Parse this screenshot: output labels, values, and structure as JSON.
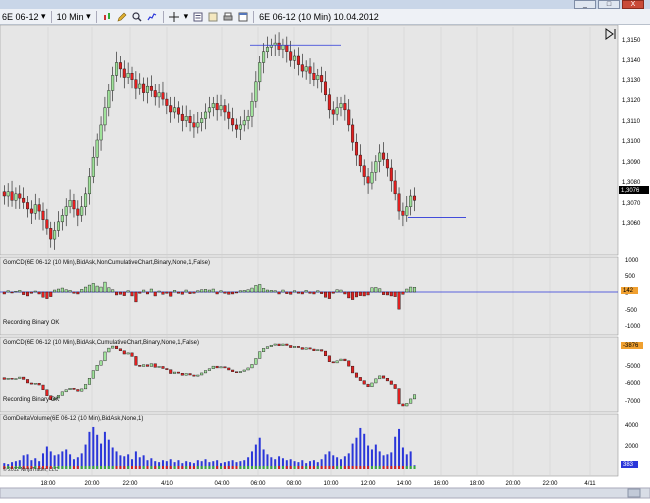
{
  "window": {
    "buttons": [
      "_",
      "□",
      "X"
    ]
  },
  "toolbar": {
    "instrument": "6E 06-12",
    "interval": "10 Min",
    "date_label": "6E 06-12 (10 Min)  10.04.2012",
    "icons": [
      "chart-style-icon",
      "pencil-icon",
      "zoom-icon",
      "indicators-icon",
      "crosshair-icon",
      "properties-icon",
      "data-box-icon",
      "print-icon",
      "window-icon"
    ]
  },
  "price_axis": {
    "ticks": [
      "1,3150",
      "1,3140",
      "1,3130",
      "1,3120",
      "1,3110",
      "1,3100",
      "1,3090",
      "1,3080",
      "1,3070",
      "1,3060"
    ],
    "current": "1,3076"
  },
  "panels": {
    "p1": {
      "title": "GomCD(6E 06-12 (10 Min),BidAsk,NonCumulativeChart,Binary,None,1,False)",
      "ticks": [
        "1000",
        "500",
        "0",
        "-500",
        "-1000"
      ],
      "status": "Recording Binary OK",
      "value": "142"
    },
    "p2": {
      "title": "GomCD(6E 06-12 (10 Min),BidAsk,CumulativeChart,Binary,None,1,False)",
      "ticks": [
        "-5000",
        "-6000",
        "-7000"
      ],
      "status": "Recording Binary OK",
      "value": "-3876"
    },
    "p3": {
      "title": "GomDeltaVolume(6E 06-12 (10 Min),BidAsk,None,1)",
      "ticks": [
        "4000",
        "2000"
      ],
      "value": "383",
      "copyright": "© 2012 NinjaTrader, LLC"
    }
  },
  "time_axis": [
    "18:00",
    "20:00",
    "22:00",
    "4/10",
    "04:00",
    "06:00",
    "08:00",
    "10:00",
    "12:00",
    "14:00",
    "16:00",
    "18:00",
    "20:00",
    "22:00",
    "4/11"
  ],
  "colors": {
    "up": "#9fe29a",
    "down": "#e12020",
    "line": "#2a36d9",
    "background": "#e6e6e6"
  },
  "chart_data": {
    "type": "candlestick",
    "start_time": "17:00",
    "bar_interval_minutes": 10,
    "price_ylim": [
      1.3053,
      1.3157
    ],
    "horizontal_lines": [
      1.3149,
      1.3069
    ],
    "arrow_down_at": "14:20",
    "price_close": [
      1.3079,
      1.3081,
      1.3077,
      1.308,
      1.3078,
      1.3076,
      1.3073,
      1.3071,
      1.3075,
      1.3072,
      1.3068,
      1.3064,
      1.3059,
      1.3063,
      1.3067,
      1.307,
      1.3074,
      1.3077,
      1.3073,
      1.307,
      1.3074,
      1.308,
      1.3088,
      1.3097,
      1.3105,
      1.3112,
      1.312,
      1.3128,
      1.3135,
      1.3141,
      1.3138,
      1.3134,
      1.3136,
      1.3133,
      1.3129,
      1.3131,
      1.3127,
      1.313,
      1.3128,
      1.3125,
      1.3127,
      1.3124,
      1.3121,
      1.3118,
      1.312,
      1.3117,
      1.3114,
      1.3116,
      1.3113,
      1.3111,
      1.3113,
      1.3115,
      1.3118,
      1.312,
      1.3122,
      1.3119,
      1.3121,
      1.3118,
      1.3115,
      1.3112,
      1.311,
      1.3112,
      1.3114,
      1.3116,
      1.3123,
      1.3132,
      1.3141,
      1.3146,
      1.3148,
      1.3149,
      1.315,
      1.3147,
      1.3149,
      1.3146,
      1.3142,
      1.3144,
      1.314,
      1.3137,
      1.3139,
      1.3136,
      1.3133,
      1.3135,
      1.3132,
      1.3126,
      1.3119,
      1.3117,
      1.312,
      1.3122,
      1.3119,
      1.3112,
      1.3104,
      1.3098,
      1.3093,
      1.3088,
      1.3085,
      1.309,
      1.3095,
      1.3099,
      1.3096,
      1.3092,
      1.3086,
      1.308,
      1.3072,
      1.307,
      1.3074,
      1.3079,
      1.3077
    ],
    "delta": [
      -60,
      40,
      -30,
      20,
      50,
      -80,
      -120,
      -40,
      30,
      -60,
      -160,
      -200,
      -140,
      60,
      90,
      120,
      70,
      50,
      -40,
      -60,
      80,
      150,
      210,
      260,
      180,
      150,
      300,
      130,
      70,
      -90,
      -70,
      -110,
      40,
      -120,
      -300,
      -40,
      60,
      -60,
      90,
      -120,
      30,
      -70,
      -40,
      -130,
      50,
      -40,
      -70,
      60,
      -50,
      -40,
      40,
      70,
      80,
      60,
      90,
      -60,
      40,
      -40,
      -70,
      -60,
      -30,
      40,
      50,
      70,
      120,
      200,
      230,
      110,
      60,
      50,
      40,
      -60,
      60,
      -50,
      -70,
      40,
      -40,
      -60,
      50,
      -40,
      -60,
      40,
      -50,
      -160,
      -200,
      -40,
      70,
      60,
      -60,
      -180,
      -230,
      -150,
      -110,
      -120,
      -90,
      130,
      140,
      100,
      -80,
      -90,
      -120,
      -140,
      -520,
      -70,
      90,
      150,
      142
    ],
    "volume": [
      600,
      500,
      700,
      800,
      900,
      1400,
      1500,
      900,
      1100,
      800,
      1600,
      2300,
      1800,
      1400,
      1500,
      1800,
      2000,
      1500,
      1000,
      1200,
      1600,
      2500,
      3800,
      4300,
      3500,
      2600,
      3800,
      3000,
      2200,
      1800,
      1400,
      1300,
      1500,
      1000,
      1800,
      1200,
      1400,
      900,
      1100,
      800,
      700,
      900,
      800,
      1000,
      700,
      900,
      600,
      800,
      700,
      600,
      900,
      800,
      1000,
      700,
      800,
      900,
      600,
      700,
      800,
      900,
      700,
      800,
      900,
      1200,
      1800,
      2500,
      3200,
      2000,
      1500,
      1200,
      1000,
      1300,
      1100,
      900,
      1000,
      800,
      700,
      900,
      600,
      800,
      900,
      700,
      1000,
      1500,
      1800,
      1400,
      1200,
      1000,
      1300,
      1600,
      2600,
      3200,
      4200,
      3600,
      2400,
      2000,
      2500,
      1800,
      1400,
      1500,
      1700,
      3300,
      4100,
      2200,
      1500,
      1800,
      383
    ]
  }
}
